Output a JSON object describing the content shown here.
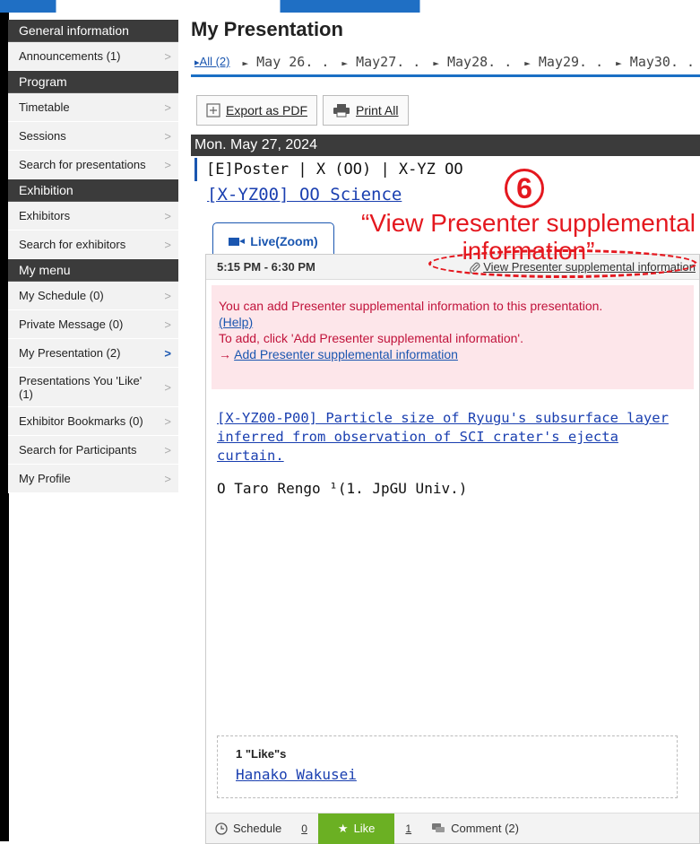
{
  "sidebar": {
    "sections": [
      {
        "title": "General information",
        "items": [
          {
            "label": "Announcements (1)"
          }
        ]
      },
      {
        "title": "Program",
        "items": [
          {
            "label": "Timetable"
          },
          {
            "label": "Sessions"
          },
          {
            "label": "Search for presentations"
          }
        ]
      },
      {
        "title": "Exhibition",
        "items": [
          {
            "label": "Exhibitors"
          },
          {
            "label": "Search for exhibitors"
          }
        ]
      },
      {
        "title": "My menu",
        "items": [
          {
            "label": "My Schedule (0)"
          },
          {
            "label": "Private Message (0)"
          },
          {
            "label": "My Presentation (2)"
          },
          {
            "label": "Presentations You 'Like' (1)"
          },
          {
            "label": "Exhibitor Bookmarks (0)"
          },
          {
            "label": "Search for Participants"
          },
          {
            "label": "My Profile"
          }
        ]
      }
    ]
  },
  "main": {
    "title": "My Presentation",
    "tabs": {
      "all": "All (2)",
      "dates": [
        "May 26. .",
        "May27. .",
        "May28. .",
        "May29. .",
        "May30. ."
      ]
    },
    "buttons": {
      "export": "Export as PDF",
      "print": "Print All"
    },
    "day": "Mon. May 27, 2024",
    "session_header": "[E]Poster | X (OO)  | X-YZ OO",
    "session_title": "[X-YZ00] OO Science",
    "live_button": "Live(Zoom)",
    "card": {
      "time": "5:15 PM - 6:30 PM",
      "supplemental_link": "View Presenter supplemental information",
      "notice_line1": "You can add Presenter supplemental information to this presentation.",
      "notice_help": "(Help)",
      "notice_line2": "To add, click 'Add Presenter supplemental information'.",
      "notice_arrow": "→",
      "notice_add_link": "Add Presenter supplemental information",
      "presentation_title": "[X-YZ00-P00] Particle size of Ryugu's subsurface layer inferred from observation of SCI crater's ejecta curtain.",
      "author": "O Taro Rengo ¹(1. JpGU Univ.)",
      "likes_count": "1 \"Like\"s",
      "liker": "Hanako Wakusei",
      "actions": {
        "schedule": "Schedule",
        "schedule_count": "0",
        "like": "Like",
        "like_count": "1",
        "comment": "Comment (2)"
      }
    }
  },
  "annotation": {
    "number": "6",
    "text": "“View Presenter supplemental information”"
  }
}
